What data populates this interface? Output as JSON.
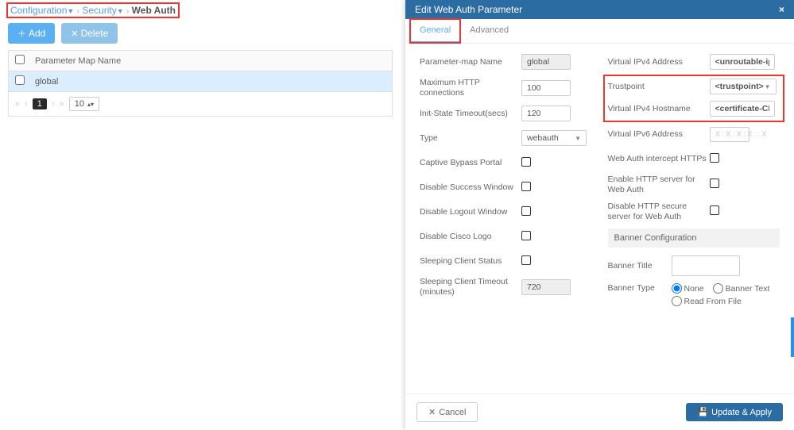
{
  "breadcrumb": {
    "l1": "Configuration",
    "l2": "Security",
    "l3": "Web Auth"
  },
  "toolbar": {
    "add": "Add",
    "delete": "Delete"
  },
  "table": {
    "header": "Parameter Map Name",
    "rows": [
      {
        "name": "global"
      }
    ]
  },
  "pager": {
    "first": "«",
    "prev": "‹",
    "current": "1",
    "next": "›",
    "last": "»",
    "pagesize": "10"
  },
  "modal": {
    "title": "Edit Web Auth Parameter",
    "close": "×",
    "tabs": {
      "general": "General",
      "advanced": "Advanced"
    },
    "left": {
      "param_name_label": "Parameter-map Name",
      "param_name_value": "global",
      "max_http_label": "Maximum HTTP connections",
      "max_http_value": "100",
      "init_timeout_label": "Init-State Timeout(secs)",
      "init_timeout_value": "120",
      "type_label": "Type",
      "type_value": "webauth",
      "captive_label": "Captive Bypass Portal",
      "dsuccess_label": "Disable Success Window",
      "dlogout_label": "Disable Logout Window",
      "dlogo_label": "Disable Cisco Logo",
      "sleep_status_label": "Sleeping Client Status",
      "sleep_timeout_label": "Sleeping Client Timeout (minutes)",
      "sleep_timeout_value": "720"
    },
    "right": {
      "vip4addr_label": "Virtual IPv4 Address",
      "vip4addr_value": "<unroutable-ip>",
      "trustpoint_label": "Trustpoint",
      "trustpoint_value": "<trustpoint>",
      "vip4host_label": "Virtual IPv4 Hostname",
      "vip4host_value": "<certificate-CN>",
      "vip6addr_label": "Virtual IPv6 Address",
      "vip6addr_value": "X:X:X:X::X",
      "intercept_label": "Web Auth intercept HTTPs",
      "httpserver_label": "Enable HTTP server for Web Auth",
      "dsecure_label": "Disable HTTP secure server for Web Auth",
      "banner_hd": "Banner Configuration",
      "banner_title_label": "Banner Title",
      "banner_type_label": "Banner Type",
      "r_none": "None",
      "r_text": "Banner Text",
      "r_file": "Read From File"
    },
    "footer": {
      "cancel": "Cancel",
      "apply": "Update & Apply"
    }
  }
}
